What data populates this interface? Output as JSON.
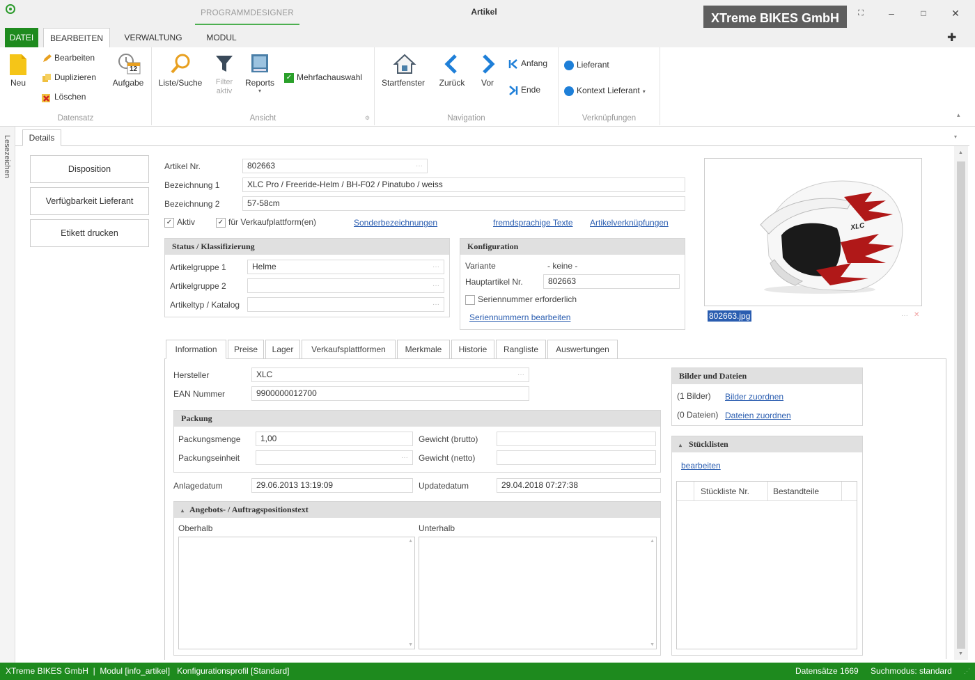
{
  "window": {
    "context_tab": "PROGRAMMDESIGNER",
    "title": "Artikel",
    "company": "XTreme BIKES GmbH"
  },
  "menu": {
    "tabs": [
      "DATEI",
      "BEARBEITEN",
      "VERWALTUNG",
      "MODUL"
    ]
  },
  "ribbon": {
    "datensatz": {
      "label": "Datensatz",
      "neu": "Neu",
      "bearbeiten": "Bearbeiten",
      "duplizieren": "Duplizieren",
      "loeschen": "Löschen",
      "aufgabe": "Aufgabe",
      "aufgabe_badge": "12"
    },
    "ansicht": {
      "label": "Ansicht",
      "liste": "Liste/Suche",
      "filter": "Filter aktiv",
      "reports": "Reports",
      "mehrfach": "Mehrfachauswahl"
    },
    "navigation": {
      "label": "Navigation",
      "startfenster": "Startfenster",
      "zurueck": "Zurück",
      "vor": "Vor",
      "anfang": "Anfang",
      "ende": "Ende"
    },
    "verknuepfungen": {
      "label": "Verknüpfungen",
      "lieferant": "Lieferant",
      "kontext": "Kontext Lieferant"
    }
  },
  "sidetab": "Lesezeichen",
  "details_tab": "Details",
  "left_buttons": [
    "Disposition",
    "Verfügbarkeit Lieferant",
    "Etikett drucken"
  ],
  "article": {
    "nr_label": "Artikel Nr.",
    "nr": "802663",
    "bez1_label": "Bezeichnung 1",
    "bez1": "XLC Pro / Freeride-Helm / BH-F02 / Pinatubo / weiss",
    "bez2_label": "Bezeichnung 2",
    "bez2": "57-58cm",
    "aktiv": "Aktiv",
    "verkauf": "für Verkaufplattform(en)",
    "link_sonder": "Sonderbezeichnungen",
    "link_fremd": "fremdsprachige Texte",
    "link_verkn": "Artikelverknüpfungen"
  },
  "status": {
    "title": "Status / Klassifizierung",
    "grp1_label": "Artikelgruppe 1",
    "grp1": "Helme",
    "grp2_label": "Artikelgruppe 2",
    "grp2": "",
    "typ_label": "Artikeltyp / Katalog",
    "typ": ""
  },
  "konfig": {
    "title": "Konfiguration",
    "variante_label": "Variante",
    "variante": "- keine -",
    "haupt_label": "Hauptartikel Nr.",
    "haupt": "802663",
    "serien": "Seriennummer erforderlich",
    "serien_link": "Seriennummern bearbeiten"
  },
  "image": {
    "filename": "802663.jpg",
    "helmet_brand": "XLC"
  },
  "tabs": [
    "Information",
    "Preise",
    "Lager",
    "Verkaufsplattformen",
    "Merkmale",
    "Historie",
    "Rangliste",
    "Auswertungen"
  ],
  "info": {
    "hersteller_label": "Hersteller",
    "hersteller": "XLC",
    "ean_label": "EAN Nummer",
    "ean": "9900000012700",
    "packung_title": "Packung",
    "menge_label": "Packungsmenge",
    "menge": "1,00",
    "einheit_label": "Packungseinheit",
    "einheit": "",
    "brutto_label": "Gewicht (brutto)",
    "brutto": "",
    "netto_label": "Gewicht (netto)",
    "netto": "",
    "anlage_label": "Anlagedatum",
    "anlage": "29.06.2013 13:19:09",
    "update_label": "Updatedatum",
    "update": "29.04.2018 07:27:38",
    "angebot_title": "Angebots- / Auftragspositionstext",
    "oberhalb": "Oberhalb",
    "unterhalb": "Unterhalb"
  },
  "bilder": {
    "title": "Bilder und Dateien",
    "bilder_count": "(1 Bilder)",
    "bilder_link": "Bilder zuordnen",
    "dateien_count": "(0 Dateien)",
    "dateien_link": "Dateien zuordnen"
  },
  "stueck": {
    "title": "Stücklisten",
    "link": "bearbeiten",
    "col1": "Stückliste Nr.",
    "col2": "Bestandteile"
  },
  "statusbar": {
    "left": "XTreme BIKES GmbH  |  Modul [info_artikel]   Konfigurationsprofil [Standard]",
    "records": "Datensätze 1669",
    "mode": "Suchmodus: standard"
  },
  "colors": {
    "accent_green": "#1e8a1e",
    "link_blue": "#2a5db0",
    "company_bg": "#5e5e5e"
  }
}
